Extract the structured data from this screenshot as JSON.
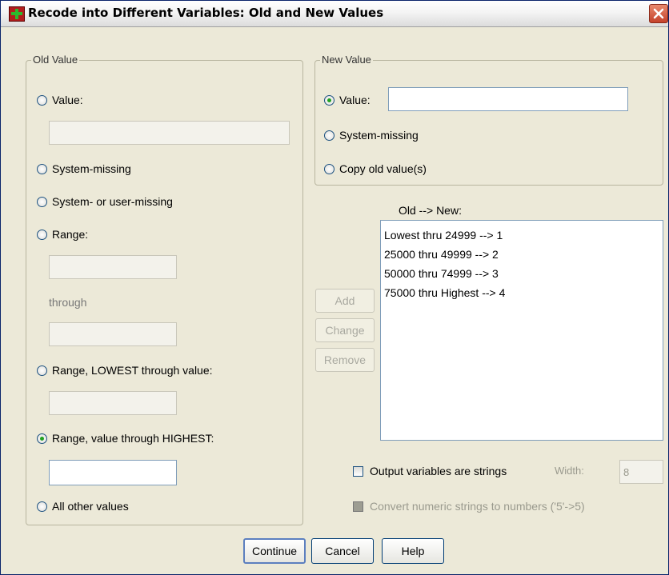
{
  "window": {
    "title": "Recode into Different Variables: Old and New Values",
    "close_glyph": "✕"
  },
  "old_value": {
    "legend": "Old Value",
    "value_label": "Value:",
    "value_input": "",
    "system_missing_label": "System-missing",
    "system_user_missing_label": "System- or user-missing",
    "range_label": "Range:",
    "range_from_input": "",
    "through_label": "through",
    "range_to_input": "",
    "range_lowest_label": "Range, LOWEST through value:",
    "range_lowest_input": "",
    "range_highest_label": "Range, value through HIGHEST:",
    "range_highest_input": "",
    "all_other_label": "All other values",
    "selected": "range_highest"
  },
  "new_value": {
    "legend": "New Value",
    "value_label": "Value:",
    "value_input": "",
    "system_missing_label": "System-missing",
    "copy_old_label": "Copy old value(s)",
    "selected": "value"
  },
  "mapping": {
    "list_label": "Old --> New:",
    "items": [
      "Lowest thru 24999 --> 1",
      "25000 thru 49999 --> 2",
      "50000 thru 74999 --> 3",
      "75000 thru Highest --> 4"
    ],
    "add_label": "Add",
    "change_label": "Change",
    "remove_label": "Remove"
  },
  "options": {
    "output_strings_label": "Output variables are strings",
    "output_strings_checked": false,
    "width_label": "Width:",
    "width_value": "8",
    "convert_label": "Convert numeric strings to numbers ('5'->5)",
    "convert_checked": false
  },
  "footer": {
    "continue_label": "Continue",
    "cancel_label": "Cancel",
    "help_label": "Help"
  },
  "colors": {
    "dialog_bg": "#ece9d8",
    "radio_selected": "#21a121",
    "title_icon": "#b21d1d"
  }
}
